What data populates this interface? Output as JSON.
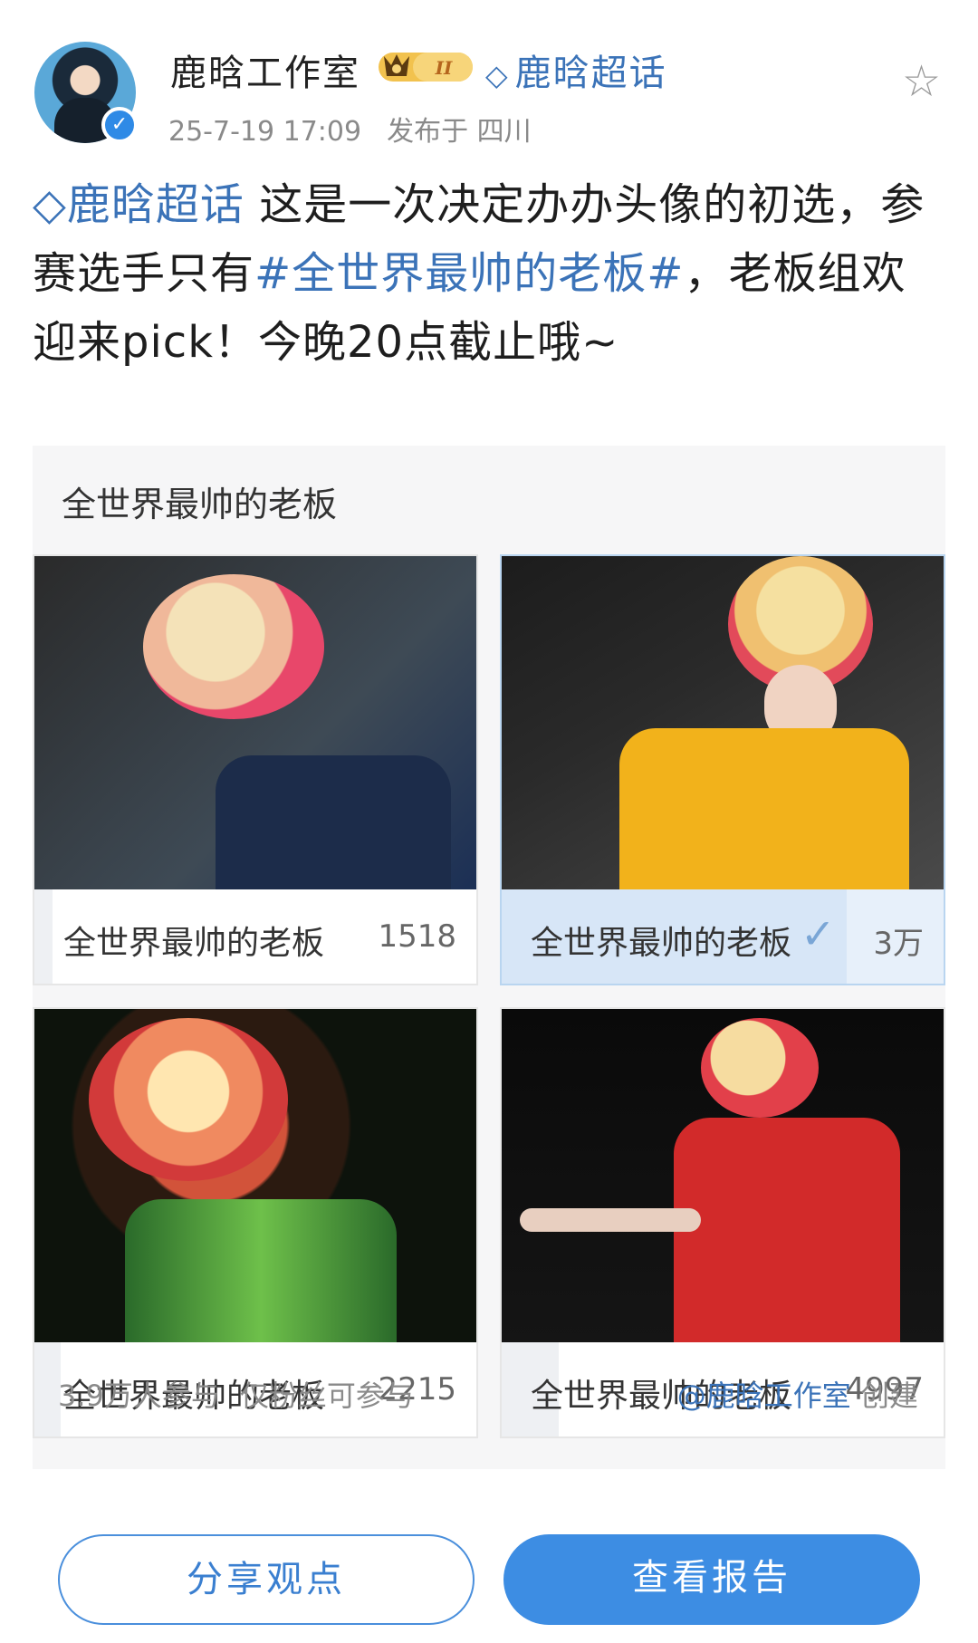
{
  "post": {
    "author": "鹿晗工作室",
    "level_badge": "II",
    "topic_tag": "鹿晗超话",
    "time": "25-7-19 17:09",
    "location": "发布于 四川"
  },
  "content": {
    "topic_link": "鹿晗超话",
    "text_1": "这是一次决定办办头像的初选，参赛选手只有",
    "hashtag": "#全世界最帅的老板#",
    "text_2": "，老板组欢迎来pick！今晚20点截止哦~"
  },
  "vote": {
    "title": "全世界最帅的老板",
    "options": [
      {
        "label": "全世界最帅的老板",
        "count": "1518",
        "fraction": 0.04,
        "selected": false
      },
      {
        "label": "全世界最帅的老板",
        "count": "3万",
        "fraction": 0.78,
        "selected": true
      },
      {
        "label": "全世界最帅的老板",
        "count": "2215",
        "fraction": 0.06,
        "selected": false
      },
      {
        "label": "全世界最帅的老板",
        "count": "4997",
        "fraction": 0.13,
        "selected": false
      }
    ],
    "participants": "3.9万人参与",
    "restriction": "仅粉丝可参与",
    "creator": "@鹿晗工作室",
    "creator_suffix": "创建"
  },
  "buttons": {
    "share": "分享观点",
    "report": "查看报告"
  },
  "icons": {
    "favorite": "star-outline-icon",
    "verified": "verified-icon",
    "topic": "diamond-icon",
    "selected": "check-icon"
  },
  "colors": {
    "accent": "#3b73b8",
    "primary_button": "#3d8de3"
  }
}
